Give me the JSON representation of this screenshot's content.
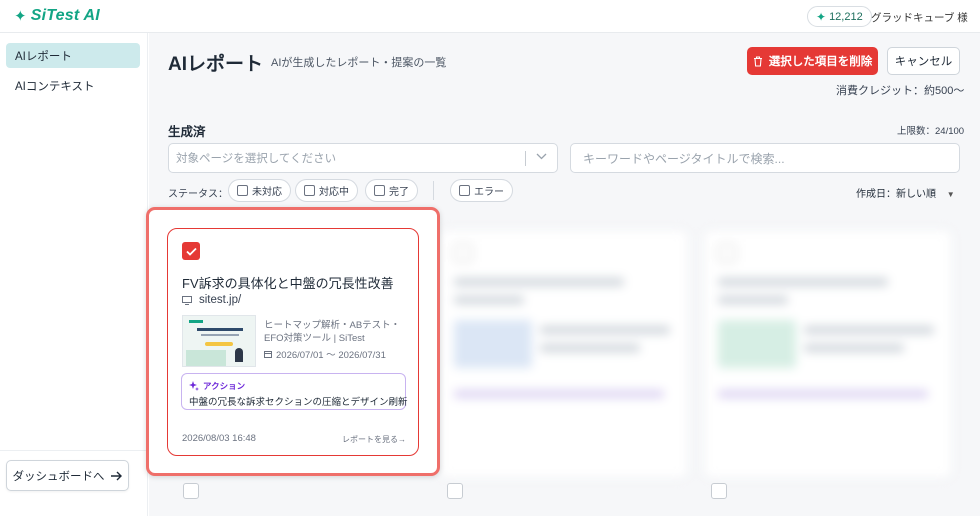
{
  "header": {
    "logo_text": "SiTest AI",
    "credits": "12,212",
    "user": "グラッドキューブ 様"
  },
  "sidebar": {
    "items": [
      {
        "label": "AIレポート",
        "active": true
      },
      {
        "label": "AIコンテキスト",
        "active": false
      }
    ],
    "dashboard_button": "ダッシュボードへ"
  },
  "page": {
    "title": "AIレポート",
    "subtitle": "AIが生成したレポート・提案の一覧",
    "delete_button": "選択した項目を削除",
    "cancel_button": "キャンセル",
    "consumption": "消費クレジット：約500〜"
  },
  "filters": {
    "section_title": "生成済",
    "limit": "上限数：24/100",
    "page_select_placeholder": "対象ページを選択してください",
    "search_placeholder": "キーワードやページタイトルで検索...",
    "status_label": "ステータス：",
    "statuses": [
      "未対応",
      "対応中",
      "完了"
    ],
    "error_chip": "エラー",
    "sort": "作成日：新しい順"
  },
  "card": {
    "checked": true,
    "title": "FV訴求の具体化と中盤の冗長性改善",
    "url": "sitest.jp/",
    "description": "ヒートマップ解析・ABテスト・EFO対策ツール | SiTest",
    "period": "2026/07/01 〜 2026/07/31",
    "action_label": "アクション",
    "action_text": "中盤の冗長な訴求セクションの圧縮とデザイン刷新",
    "created": "2026/08/03 16:48",
    "link": "レポートを見る→"
  },
  "colors": {
    "brand": "#13a585",
    "danger": "#e53935",
    "sidebar_active": "#cdeaec",
    "action_border": "#c8b3f0"
  }
}
